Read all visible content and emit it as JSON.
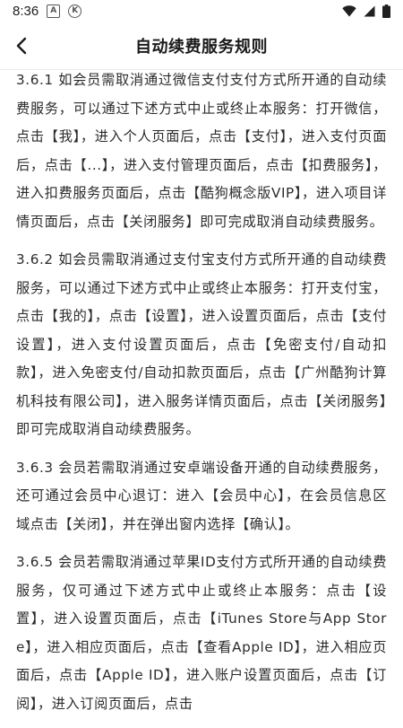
{
  "status_bar": {
    "time": "8:36",
    "icons": [
      "a-icon",
      "k-icon",
      "wifi-icon",
      "signal-icon",
      "battery-icon"
    ],
    "icon_a_text": "A",
    "icon_k_text": "K"
  },
  "header": {
    "title": "自动续费服务规则",
    "back_icon": "back-arrow-icon"
  },
  "paragraphs": [
    "3.6.1 如会员需取消通过微信支付支付方式所开通的自动续费服务，可以通过下述方式中止或终止本服务：打开微信，点击【我】，进入个人页面后，点击【支付】，进入支付页面后，点击【...】，进入支付管理页面后，点击【扣费服务】，进入扣费服务页面后，点击【酷狗概念版VIP】，进入项目详情页面后，点击【关闭服务】即可完成取消自动续费服务。",
    "3.6.2 如会员需取消通过支付宝支付方式所开通的自动续费服务，可以通过下述方式中止或终止本服务：打开支付宝，点击【我的】，点击【设置】，进入设置页面后，点击【支付设置】，进入支付设置页面后，点击【免密支付/自动扣款】，进入免密支付/自动扣款页面后，点击【广州酷狗计算机科技有限公司】，进入服务详情页面后，点击【关闭服务】即可完成取消自动续费服务。",
    "3.6.3 会员若需取消通过安卓端设备开通的自动续费服务，还可通过会员中心退订：进入【会员中心】，在会员信息区域点击【关闭】，并在弹出窗内选择【确认】。",
    "3.6.5 会员若需取消通过苹果ID支付方式所开通的自动续费服务，仅可通过下述方式中止或终止本服务：点击【设置】，进入设置页面后，点击【iTunes Store与App Store】，进入相应页面后，点击【查看Apple ID】，进入相应页面后，点击【Apple ID】，进入账户设置页面后，点击【订阅】，进入订阅页面后，点击"
  ],
  "colors": {
    "background": "#ffffff",
    "text": "#2b2b2b",
    "title": "#1a1a1a"
  }
}
